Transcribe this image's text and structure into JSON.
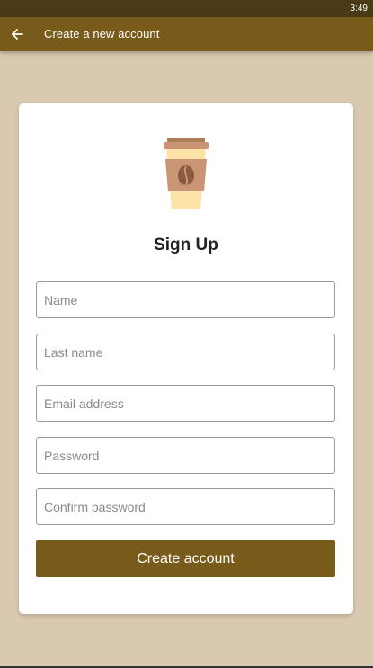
{
  "status_bar": {
    "time": "3:49"
  },
  "app_bar": {
    "title": "Create a new account",
    "back_icon": "arrow-left-icon"
  },
  "card": {
    "logo_icon": "coffee-cup-icon",
    "title": "Sign Up",
    "fields": {
      "name": {
        "placeholder": "Name",
        "value": ""
      },
      "last_name": {
        "placeholder": "Last name",
        "value": ""
      },
      "email": {
        "placeholder": "Email address",
        "value": ""
      },
      "password": {
        "placeholder": "Password",
        "value": ""
      },
      "confirm_password": {
        "placeholder": "Confirm password",
        "value": ""
      }
    },
    "submit_label": "Create account"
  },
  "colors": {
    "status_bar": "#4a3a17",
    "app_bar": "#785a1b",
    "background": "#d9c9b0",
    "button": "#785a1b",
    "card": "#ffffff"
  }
}
